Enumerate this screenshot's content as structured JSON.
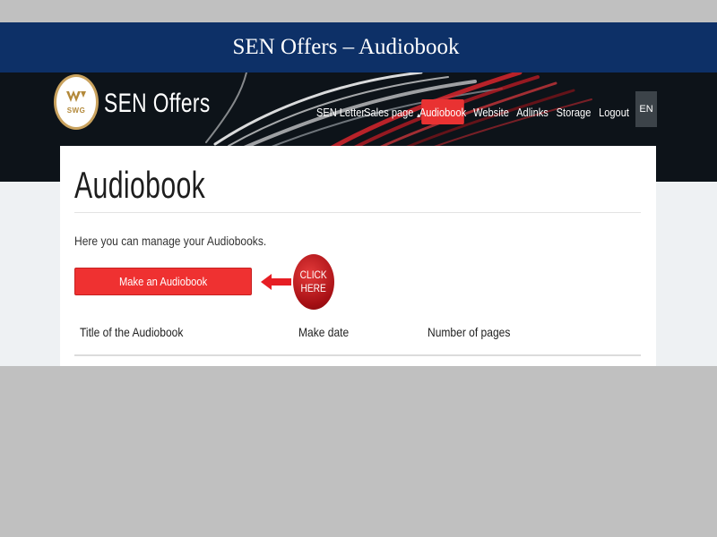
{
  "slide": {
    "title": "SEN Offers –  Audiobook"
  },
  "header": {
    "logo_text": "SWG",
    "brand": "SEN Offers",
    "nav": [
      {
        "label": "SEN Letter"
      },
      {
        "label": "Sales page"
      },
      {
        "label": "Audiobook"
      },
      {
        "label": "Website"
      },
      {
        "label": "Adlinks"
      },
      {
        "label": "Storage"
      },
      {
        "label": "Logout"
      }
    ],
    "lang": "EN"
  },
  "main": {
    "title": "Audiobook",
    "intro": "Here you can manage your Audiobooks.",
    "make_button": "Make an Audiobook",
    "click_here": [
      "CLICK",
      "HERE"
    ],
    "table_headers": [
      "Title of the Audiobook",
      "Make date",
      "Number of pages"
    ]
  },
  "colors": {
    "slide_bar": "#0d3067",
    "accent_red": "#ef3131",
    "banner_dark": "#0d1319",
    "outer_gray": "#c0c0c0"
  },
  "icons": {
    "logo": "swg-logo-icon",
    "arrow": "arrow-left-icon",
    "caret": "caret-up-icon"
  }
}
